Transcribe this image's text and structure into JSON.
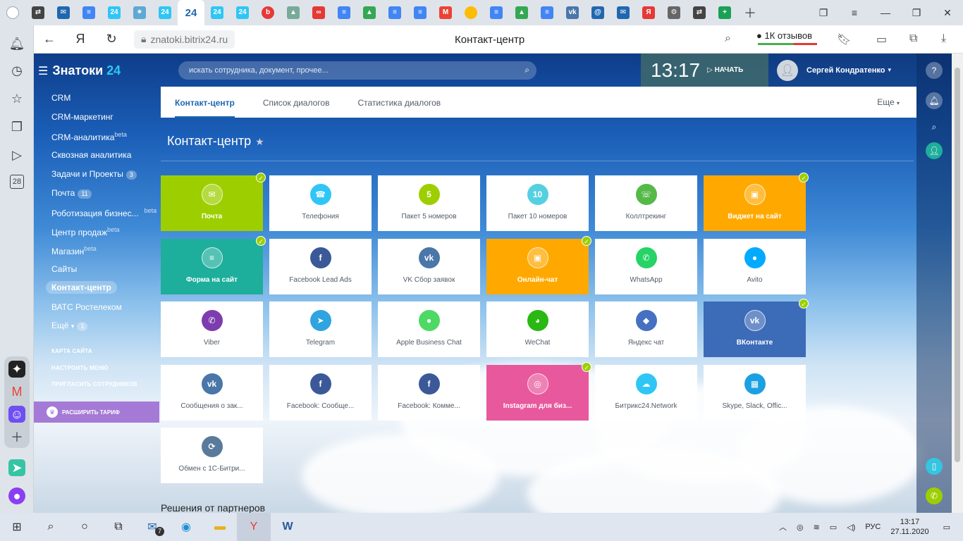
{
  "browser": {
    "url": "znatoki.bitrix24.ru",
    "page_title": "Контакт-центр",
    "reviews": "1К отзывов",
    "active_tab_label": "24"
  },
  "header": {
    "logo_main": "Знатоки",
    "logo_num": "24",
    "search_placeholder": "искать сотрудника, документ, прочее...",
    "clock": "13:17",
    "start_label": "НАЧАТЬ",
    "user_name": "Сергей Кондратенко"
  },
  "left_menu": {
    "items": [
      {
        "label": "CRM"
      },
      {
        "label": "CRM-маркетинг"
      },
      {
        "label": "CRM-аналитика",
        "sup": "beta"
      },
      {
        "label": "Сквозная аналитика"
      },
      {
        "label": "Задачи и Проекты",
        "count": "3"
      },
      {
        "label": "Почта",
        "count": "11"
      },
      {
        "label": "Роботизация бизнес...",
        "sup": "beta"
      },
      {
        "label": "Центр продаж",
        "sup": "beta"
      },
      {
        "label": "Магазин",
        "sup": "beta"
      },
      {
        "label": "Сайты"
      },
      {
        "label": "Контакт-центр"
      },
      {
        "label": "ВАТС Ростелеком"
      },
      {
        "label": "Ещё",
        "count": "1"
      }
    ],
    "links": [
      "КАРТА САЙТА",
      "НАСТРОИТЬ МЕНЮ",
      "ПРИГЛАСИТЬ СОТРУДНИКОВ"
    ],
    "upgrade": "РАСШИРИТЬ ТАРИФ"
  },
  "tabs": [
    "Контакт-центр",
    "Список диалогов",
    "Статистика диалогов"
  ],
  "more_label": "Еще",
  "page_heading": "Контакт-центр",
  "tiles": [
    {
      "label": "Почта",
      "color": "#9dcf00",
      "icon": "mail-icon",
      "glyph": "✉",
      "checked": true
    },
    {
      "label": "Телефония",
      "color": "#2fc6f6",
      "icon": "phone-icon",
      "glyph": "☎"
    },
    {
      "label": "Пакет 5 номеров",
      "color": "#9dcf00",
      "icon": "pack5-icon",
      "glyph": "5"
    },
    {
      "label": "Пакет 10 номеров",
      "color": "#55d0e0",
      "icon": "pack10-icon",
      "glyph": "10"
    },
    {
      "label": "Коллтрекинг",
      "color": "#55b948",
      "icon": "calltracking-icon",
      "glyph": "☏"
    },
    {
      "label": "Виджет на сайт",
      "color": "#ffa900",
      "icon": "widget-icon",
      "glyph": "▣",
      "checked": true
    },
    {
      "label": "Форма на сайт",
      "color": "#1eae9c",
      "icon": "form-icon",
      "glyph": "≡",
      "checked": true
    },
    {
      "label": "Facebook Lead Ads",
      "color": "#3b5998",
      "icon": "fb-lead-icon",
      "glyph": "f"
    },
    {
      "label": "VK Сбор заявок",
      "color": "#4a76a8",
      "icon": "vk-form-icon",
      "glyph": "vk"
    },
    {
      "label": "Онлайн-чат",
      "color": "#ffa900",
      "icon": "chat-icon",
      "glyph": "▣",
      "checked": true
    },
    {
      "label": "WhatsApp",
      "color": "#25d366",
      "icon": "whatsapp-icon",
      "glyph": "✆"
    },
    {
      "label": "Avito",
      "color": "#00aaff",
      "icon": "avito-icon",
      "glyph": "●"
    },
    {
      "label": "Viber",
      "color": "#7d3daf",
      "icon": "viber-icon",
      "glyph": "✆"
    },
    {
      "label": "Telegram",
      "color": "#2fa4e0",
      "icon": "telegram-icon",
      "glyph": "➤"
    },
    {
      "label": "Apple Business Chat",
      "color": "#4cd964",
      "icon": "apple-chat-icon",
      "glyph": "●"
    },
    {
      "label": "WeChat",
      "color": "#2ab813",
      "icon": "wechat-icon",
      "glyph": "◕"
    },
    {
      "label": "Яндекс чат",
      "color": "#4670c1",
      "icon": "yandex-chat-icon",
      "glyph": "◆"
    },
    {
      "label": "ВКонтакте",
      "color": "#3c6bb8",
      "icon": "vk-icon",
      "glyph": "vk",
      "checked": true
    },
    {
      "label": "Сообщения о зак...",
      "color": "#4a76a8",
      "icon": "vk-orders-icon",
      "glyph": "vk"
    },
    {
      "label": "Facebook: Сообще...",
      "color": "#3b5998",
      "icon": "fb-messages-icon",
      "glyph": "f"
    },
    {
      "label": "Facebook: Комме...",
      "color": "#3b5998",
      "icon": "fb-comments-icon",
      "glyph": "f"
    },
    {
      "label": "Instagram для биз...",
      "color": "#e8589d",
      "icon": "instagram-icon",
      "glyph": "◎",
      "checked": true
    },
    {
      "label": "Битрикс24.Network",
      "color": "#2fc6f6",
      "icon": "b24-network-icon",
      "glyph": "☁"
    },
    {
      "label": "Skype, Slack, Offic...",
      "color": "#1ba1e2",
      "icon": "skype-slack-icon",
      "glyph": "▦"
    },
    {
      "label": "Обмен с 1С-Битри...",
      "color": "#5a7a9c",
      "icon": "exchange-1c-icon",
      "glyph": "⟳"
    }
  ],
  "partners_heading": "Решения от партнеров",
  "taskbar": {
    "lang": "РУС",
    "time": "13:17",
    "date": "27.11.2020",
    "mail_badge": "7"
  },
  "colors": {
    "accent": "#2067b0",
    "b24_blue": "#2fc6f6",
    "check": "#9dcf00"
  }
}
